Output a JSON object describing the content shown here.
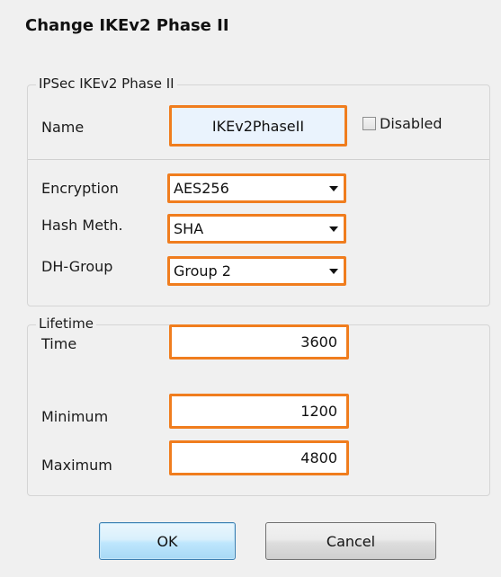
{
  "dialog": {
    "title": "Change IKEv2 Phase II"
  },
  "ipsec_group": {
    "legend": "IPSec IKEv2 Phase II",
    "name_label": "Name",
    "name_value": "IKEv2PhaseII",
    "disabled_label": "Disabled",
    "disabled_checked": false,
    "encryption_label": "Encryption",
    "encryption_value": "AES256",
    "hash_label": "Hash Meth.",
    "hash_value": "SHA",
    "dh_label": "DH-Group",
    "dh_value": "Group 2"
  },
  "lifetime_group": {
    "legend": "Lifetime",
    "time_label": "Time",
    "time_value": "3600",
    "minimum_label": "Minimum",
    "minimum_value": "1200",
    "maximum_label": "Maximum",
    "maximum_value": "4800"
  },
  "buttons": {
    "ok_label": "OK",
    "cancel_label": "Cancel"
  },
  "colors": {
    "highlight_border": "#f07d1e",
    "ok_button": "#bee6fd"
  },
  "icons": {
    "dropdown": "triangle-down-icon"
  }
}
